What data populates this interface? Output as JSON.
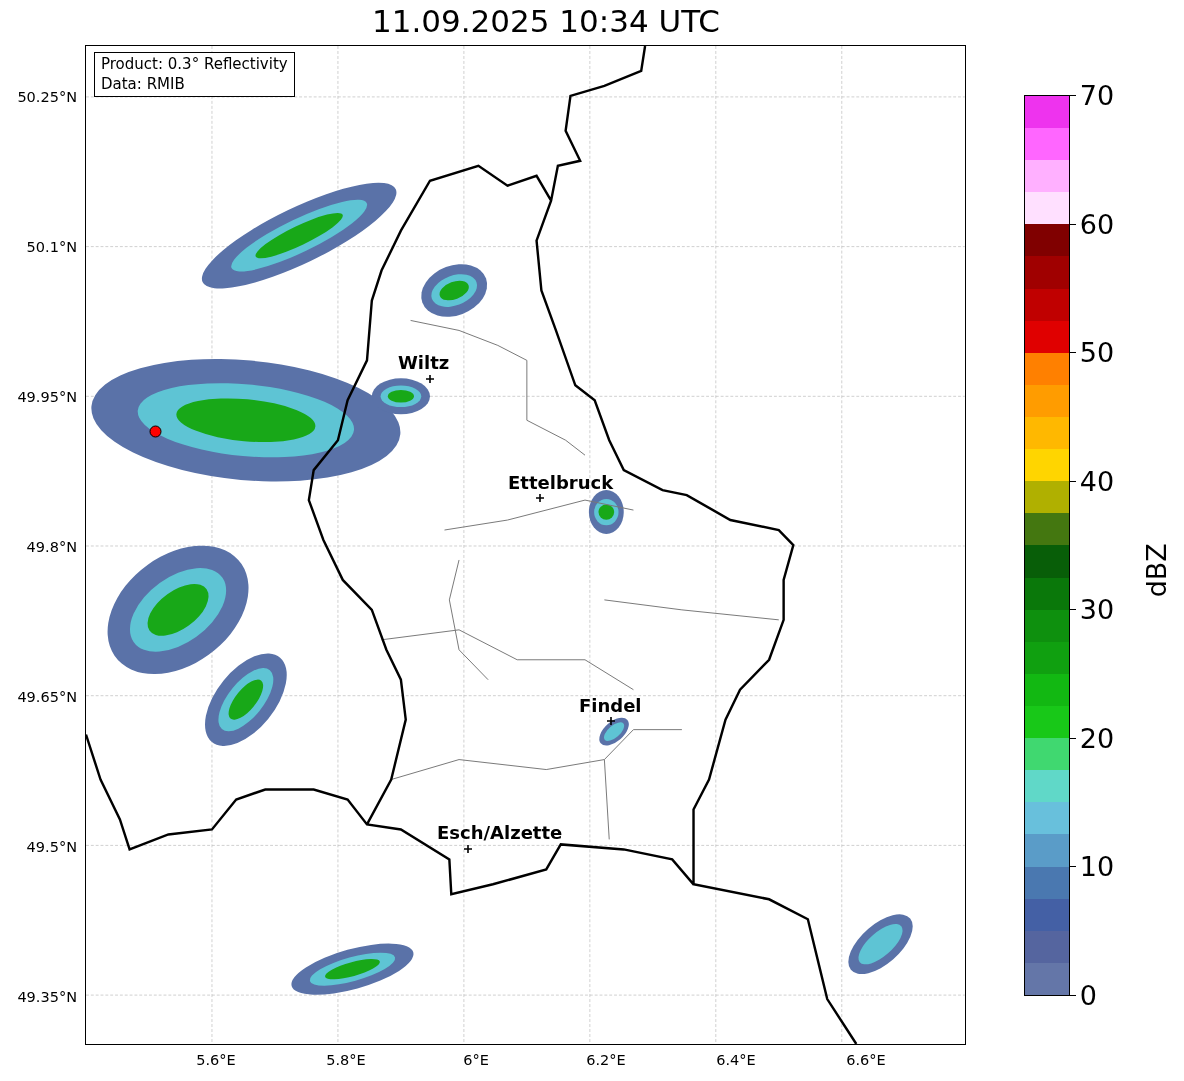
{
  "title": "11.09.2025 10:34 UTC",
  "info_box": {
    "lines": [
      "Product: 0.3° Reflectivity",
      "Data: RMIB"
    ]
  },
  "map": {
    "y_ticks": [
      "50.25°N",
      "50.1°N",
      "49.95°N",
      "49.8°N",
      "49.65°N",
      "49.5°N",
      "49.35°N"
    ],
    "x_ticks": [
      "5.6°E",
      "5.8°E",
      "6°E",
      "6.2°E",
      "6.4°E",
      "6.6°E"
    ],
    "cities": [
      {
        "name": "Wiltz"
      },
      {
        "name": "Ettelbruck"
      },
      {
        "name": "Findel"
      },
      {
        "name": "Esch/Alzette"
      }
    ]
  },
  "colorbar": {
    "label": "dBZ",
    "ticks": [
      "70",
      "60",
      "50",
      "40",
      "30",
      "20",
      "10",
      "0"
    ],
    "levels": [
      {
        "color": "#6476a8"
      },
      {
        "color": "#55659f"
      },
      {
        "color": "#4460a5"
      },
      {
        "color": "#4a78b0"
      },
      {
        "color": "#5a9cc8"
      },
      {
        "color": "#68c0dc"
      },
      {
        "color": "#60d8c8"
      },
      {
        "color": "#40d870"
      },
      {
        "color": "#18c818"
      },
      {
        "color": "#12b812"
      },
      {
        "color": "#10a010"
      },
      {
        "color": "#0e900e"
      },
      {
        "color": "#0a780a"
      },
      {
        "color": "#085e08"
      },
      {
        "color": "#447710"
      },
      {
        "color": "#b0b000"
      },
      {
        "color": "#ffd500"
      },
      {
        "color": "#ffb800"
      },
      {
        "color": "#ff9c00"
      },
      {
        "color": "#ff8000"
      },
      {
        "color": "#e00000"
      },
      {
        "color": "#c00000"
      },
      {
        "color": "#a00000"
      },
      {
        "color": "#800000"
      },
      {
        "color": "#ffe0ff"
      },
      {
        "color": "#ffb0ff"
      },
      {
        "color": "#ff66ff"
      },
      {
        "color": "#ee33ee"
      }
    ]
  }
}
